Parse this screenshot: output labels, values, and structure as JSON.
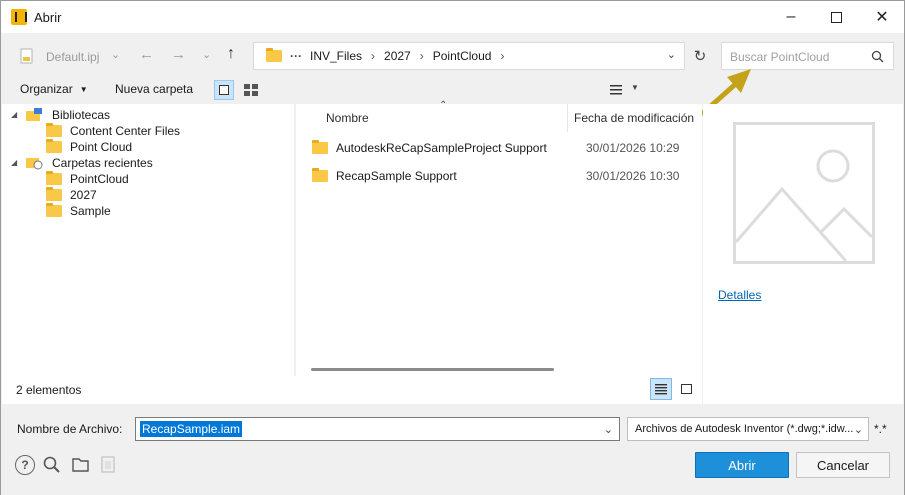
{
  "window": {
    "title": "Abrir"
  },
  "toolbar": {
    "project_file": "Default.ipj",
    "address": [
      "INV_Files",
      "2027",
      "PointCloud"
    ],
    "search_placeholder": "Buscar PointCloud",
    "organize_label": "Organizar",
    "new_folder_label": "Nueva carpeta"
  },
  "nav": {
    "libraries_label": "Bibliotecas",
    "libraries_children": [
      "Content Center Files",
      "Point Cloud"
    ],
    "recent_label": "Carpetas recientes",
    "recent_children": [
      "PointCloud",
      "2027",
      "Sample"
    ]
  },
  "files": {
    "col_name": "Nombre",
    "col_date": "Fecha de modificación",
    "rows": [
      {
        "name": "AutodeskReCapSampleProject Support",
        "date": "30/01/2026 10:29"
      },
      {
        "name": "RecapSample Support",
        "date": "30/01/2026 10:30"
      }
    ]
  },
  "preview": {
    "details_link": "Detalles"
  },
  "status": {
    "count": "2 elementos"
  },
  "bottom": {
    "filename_label": "Nombre de Archivo:",
    "filename_value": "RecapSample.iam",
    "filetype_value": "Archivos de Autodesk Inventor (*.dwg;*.idw...",
    "filter_suffix": "*.*",
    "open_label": "Abrir",
    "cancel_label": "Cancelar"
  },
  "colors": {
    "accent": "#1e90d9",
    "link": "#0066b4",
    "folder": "#f9c846",
    "annotation_arrow": "#c4a21a"
  }
}
